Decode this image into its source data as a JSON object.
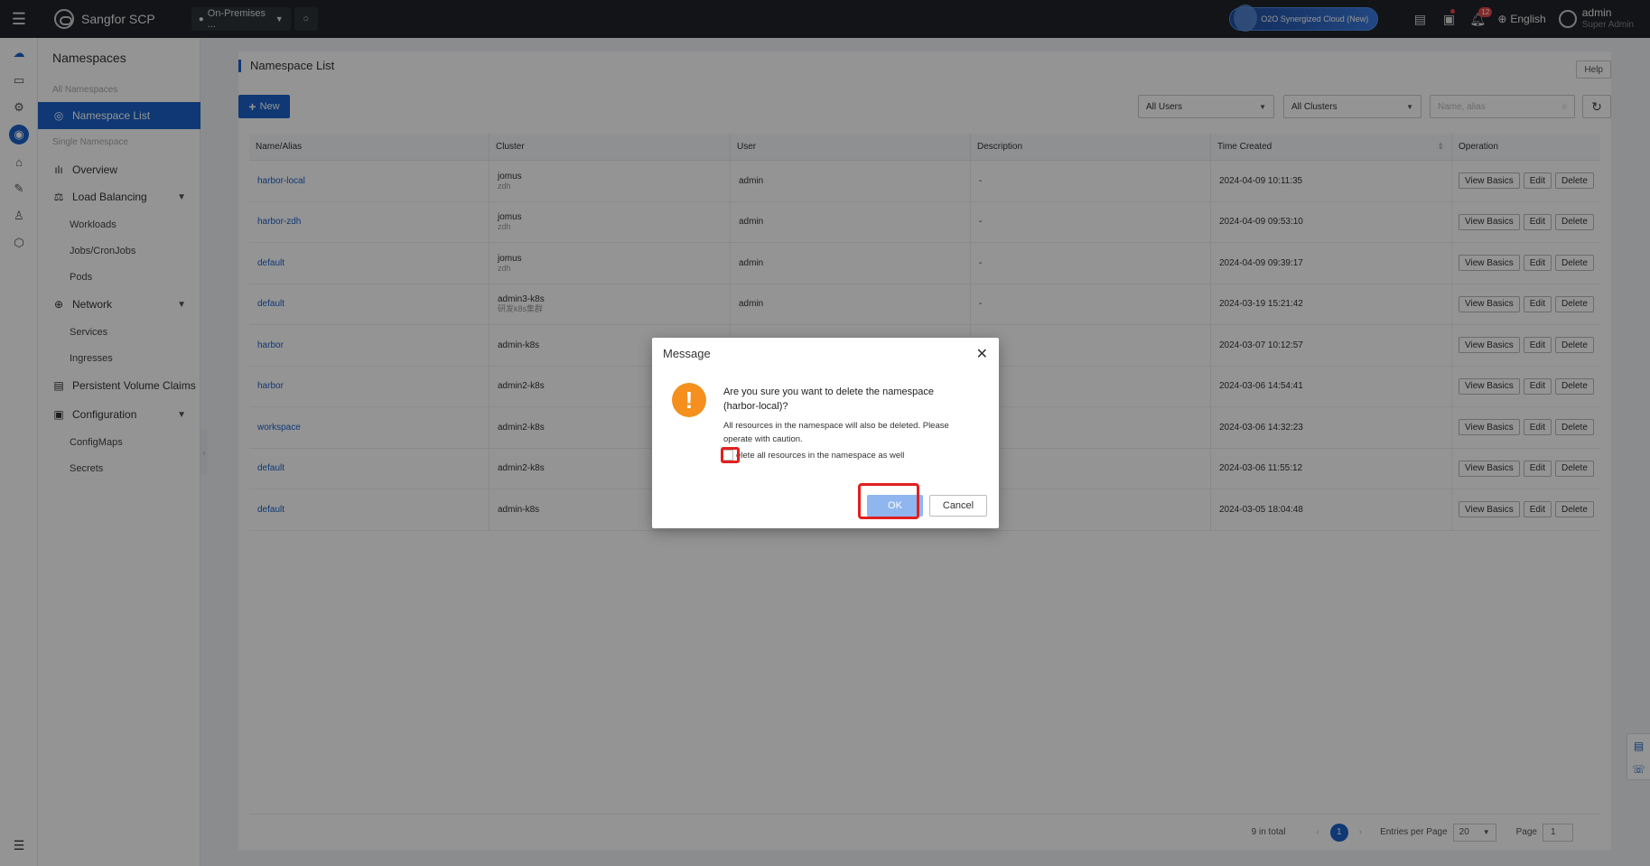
{
  "topbar": {
    "app_name": "Sangfor SCP",
    "env_select": "On-Premises ...",
    "o2o_label": "O2O Synergized Cloud (New)",
    "notification_count": "12",
    "language": "English",
    "user_name": "admin",
    "user_role": "Super Admin"
  },
  "sidenav": {
    "title": "Namespaces",
    "group_all": "All Namespaces",
    "namespace_list": "Namespace List",
    "group_single": "Single Namespace",
    "overview": "Overview",
    "load_balancing": "Load Balancing",
    "workloads": "Workloads",
    "jobs": "Jobs/CronJobs",
    "pods": "Pods",
    "network": "Network",
    "services": "Services",
    "ingresses": "Ingresses",
    "pvc": "Persistent Volume Claims",
    "configuration": "Configuration",
    "configmaps": "ConfigMaps",
    "secrets": "Secrets"
  },
  "main": {
    "title": "Namespace List",
    "help": "Help",
    "new": "New",
    "filter_users": "All Users",
    "filter_clusters": "All Clusters",
    "search_placeholder": "Name, alias",
    "columns": [
      "Name/Alias",
      "Cluster",
      "User",
      "Description",
      "Time Created",
      "Operation"
    ],
    "op_view": "View Basics",
    "op_edit": "Edit",
    "op_delete": "Delete",
    "rows": [
      {
        "name": "harbor-local",
        "cluster": "jomus",
        "cluster_sub": "zdh",
        "user": "admin",
        "desc": "-",
        "time": "2024-04-09 10:11:35"
      },
      {
        "name": "harbor-zdh",
        "cluster": "jomus",
        "cluster_sub": "zdh",
        "user": "admin",
        "desc": "-",
        "time": "2024-04-09 09:53:10"
      },
      {
        "name": "default",
        "cluster": "jomus",
        "cluster_sub": "zdh",
        "user": "admin",
        "desc": "-",
        "time": "2024-04-09 09:39:17"
      },
      {
        "name": "default",
        "cluster": "admin3-k8s",
        "cluster_sub": "研发k8s集群",
        "user": "admin",
        "desc": "-",
        "time": "2024-03-19 15:21:42"
      },
      {
        "name": "harbor",
        "cluster": "admin-k8s",
        "cluster_sub": "",
        "user": "",
        "desc": "",
        "time": "2024-03-07 10:12:57"
      },
      {
        "name": "harbor",
        "cluster": "admin2-k8s",
        "cluster_sub": "",
        "user": "",
        "desc": "",
        "time": "2024-03-06 14:54:41"
      },
      {
        "name": "workspace",
        "cluster": "admin2-k8s",
        "cluster_sub": "",
        "user": "",
        "desc": "",
        "time": "2024-03-06 14:32:23"
      },
      {
        "name": "default",
        "cluster": "admin2-k8s",
        "cluster_sub": "",
        "user": "",
        "desc": "",
        "time": "2024-03-06 11:55:12"
      },
      {
        "name": "default",
        "cluster": "admin-k8s",
        "cluster_sub": "",
        "user": "",
        "desc": "",
        "time": "2024-03-05 18:04:48"
      }
    ],
    "pagination": {
      "total": "9 in total",
      "current_page": "1",
      "entries_label": "Entries per Page",
      "entries_value": "20",
      "page_label": "Page",
      "page_value": "1"
    }
  },
  "dialog": {
    "title": "Message",
    "message": "Are you sure you want to delete the namespace (harbor-local)?",
    "note": "All resources in the namespace will also be deleted. Please operate with caution.",
    "checkbox_label": "elete all resources in the namespace as well",
    "ok": "OK",
    "cancel": "Cancel"
  },
  "colors": {
    "accent": "#1b61c8",
    "topbar": "#1f2329",
    "warning": "#f5901e",
    "highlight": "#e02020"
  }
}
